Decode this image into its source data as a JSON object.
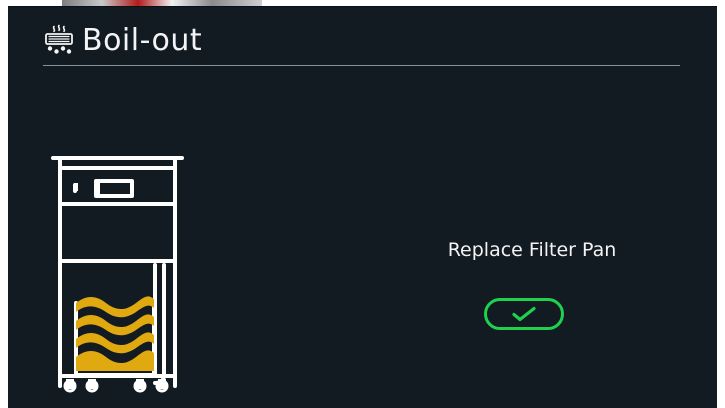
{
  "header": {
    "title": "Boil-out",
    "icon": "boil-out-icon"
  },
  "illustration": {
    "icon": "fryer-filter-pan-icon"
  },
  "main": {
    "message": "Replace Filter Pan"
  },
  "actions": {
    "confirm_icon": "checkmark-icon"
  },
  "colors": {
    "background": "#121a22",
    "text": "#f3f3f3",
    "divider": "#a6adb3",
    "accent_green": "#1fd14d",
    "illustration_white": "#ffffff",
    "filter_yellow": "#dfa90f"
  }
}
